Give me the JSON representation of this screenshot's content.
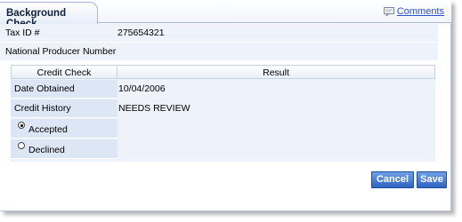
{
  "tab": {
    "title": "Background Check"
  },
  "comments": {
    "label": "Comments",
    "icon": "comment-icon"
  },
  "info": {
    "tax_id": {
      "label": "Tax ID #",
      "value": "275654321"
    },
    "npn": {
      "label": "National Producer Number",
      "value": ""
    }
  },
  "credit": {
    "col_left": "Credit Check",
    "col_right": "Result",
    "date_obtained": {
      "label": "Date Obtained",
      "value": "10/04/2006"
    },
    "credit_history": {
      "label": "Credit History",
      "value": "NEEDS REVIEW"
    },
    "decision": {
      "accepted_label": "Accepted",
      "declined_label": "Declined",
      "selected": "Accepted"
    }
  },
  "buttons": {
    "cancel": "Cancel",
    "save": "Save"
  },
  "colors": {
    "accent": "#2f64c2",
    "panel_bg": "#eef2fa",
    "label_bg": "#dde6f5",
    "link": "#2a4fd0"
  }
}
